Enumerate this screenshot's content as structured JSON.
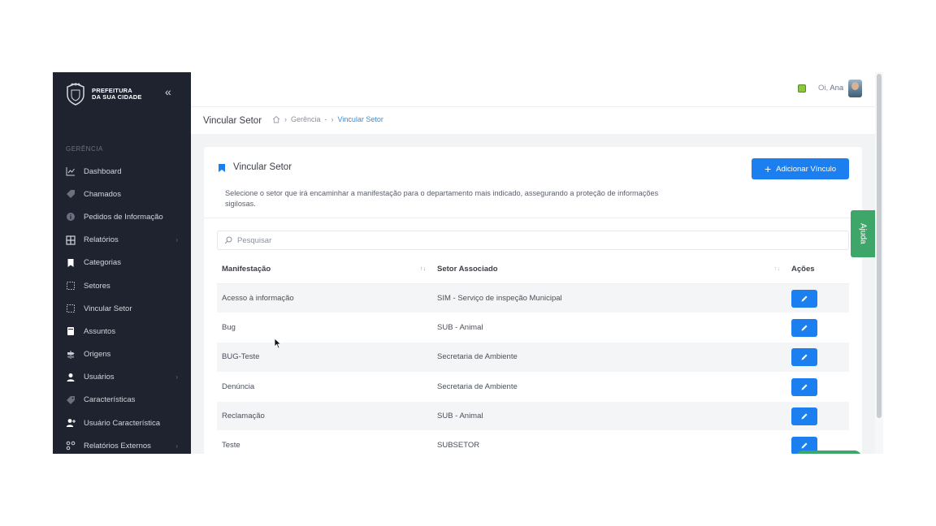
{
  "brand": {
    "line1": "PREFEITURA",
    "line2": "DA SUA CIDADE"
  },
  "sidebar": {
    "section": "GERÊNCIA",
    "items": [
      {
        "label": "Dashboard",
        "icon": "chart-line-icon",
        "caret": false
      },
      {
        "label": "Chamados",
        "icon": "tag-icon",
        "caret": false
      },
      {
        "label": "Pedidos de Informação",
        "icon": "info-icon",
        "caret": false
      },
      {
        "label": "Relatórios",
        "icon": "grid-icon",
        "caret": true
      },
      {
        "label": "Categorias",
        "icon": "bookmark-icon",
        "caret": false
      },
      {
        "label": "Setores",
        "icon": "dotted-square-icon",
        "caret": false
      },
      {
        "label": "Vincular Setor",
        "icon": "dotted-square-icon",
        "caret": false
      },
      {
        "label": "Assuntos",
        "icon": "book-icon",
        "caret": false
      },
      {
        "label": "Origens",
        "icon": "signpost-icon",
        "caret": false
      },
      {
        "label": "Usuários",
        "icon": "user-icon",
        "caret": true
      },
      {
        "label": "Características",
        "icon": "tags-icon",
        "caret": false
      },
      {
        "label": "Usuário Característica",
        "icon": "user-plus-icon",
        "caret": false
      },
      {
        "label": "Relatórios Externos",
        "icon": "nodes-icon",
        "caret": true
      }
    ]
  },
  "topbar": {
    "greeting": "Oi,",
    "user": "Ana"
  },
  "breadcrumb": {
    "title": "Vincular Setor",
    "items": [
      "Gerência",
      "-",
      "Vincular Setor"
    ]
  },
  "card": {
    "title": "Vincular Setor",
    "add_label": "Adicionar Vínculo",
    "description": "Selecione o setor que irá encaminhar a manifestação para o departamento mais indicado, assegurando a proteção de informações sigilosas."
  },
  "search": {
    "placeholder": "Pesquisar"
  },
  "table": {
    "headers": {
      "manifestacao": "Manifestação",
      "setor": "Setor Associado",
      "acoes": "Ações"
    },
    "sort1": "↑↓",
    "sort2": "↑↓",
    "rows": [
      {
        "manifestacao": "Acesso à informação",
        "setor": "SIM - Serviço de inspeção Municipal"
      },
      {
        "manifestacao": "Bug",
        "setor": "SUB - Animal"
      },
      {
        "manifestacao": "BUG-Teste",
        "setor": "Secretaria de Ambiente"
      },
      {
        "manifestacao": "Denúncia",
        "setor": "Secretaria de Ambiente"
      },
      {
        "manifestacao": "Reclamação",
        "setor": "SUB - Animal"
      },
      {
        "manifestacao": "Teste",
        "setor": "SUBSETOR"
      }
    ]
  },
  "help_tab": "Ajuda",
  "colors": {
    "sidebar": "#1f2330",
    "accent": "#1b7ff0",
    "help": "#3fa66a"
  }
}
